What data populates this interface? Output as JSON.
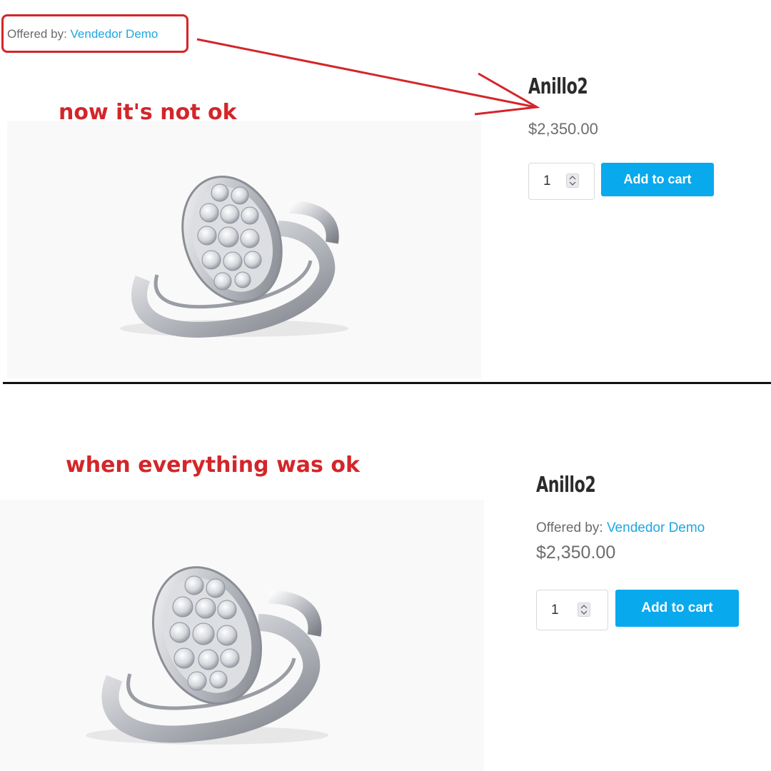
{
  "top_panel": {
    "offered_label": "Offered by:",
    "vendor_link": "Vendedor Demo",
    "annotation": "now it's not ok",
    "product_title": "Anillo2",
    "price": "$2,350.00",
    "quantity": "1",
    "add_to_cart": "Add to cart"
  },
  "bottom_panel": {
    "annotation": "when everything was ok",
    "product_title": "Anillo2",
    "offered_label": "Offered by:",
    "vendor_link": "Vendedor Demo",
    "price": "$2,350.00",
    "quantity": "1",
    "add_to_cart": "Add to cart"
  },
  "colors": {
    "annotation_red": "#d3262a",
    "vendor_link": "#1ea7e0",
    "button_blue": "#09a9ee"
  }
}
